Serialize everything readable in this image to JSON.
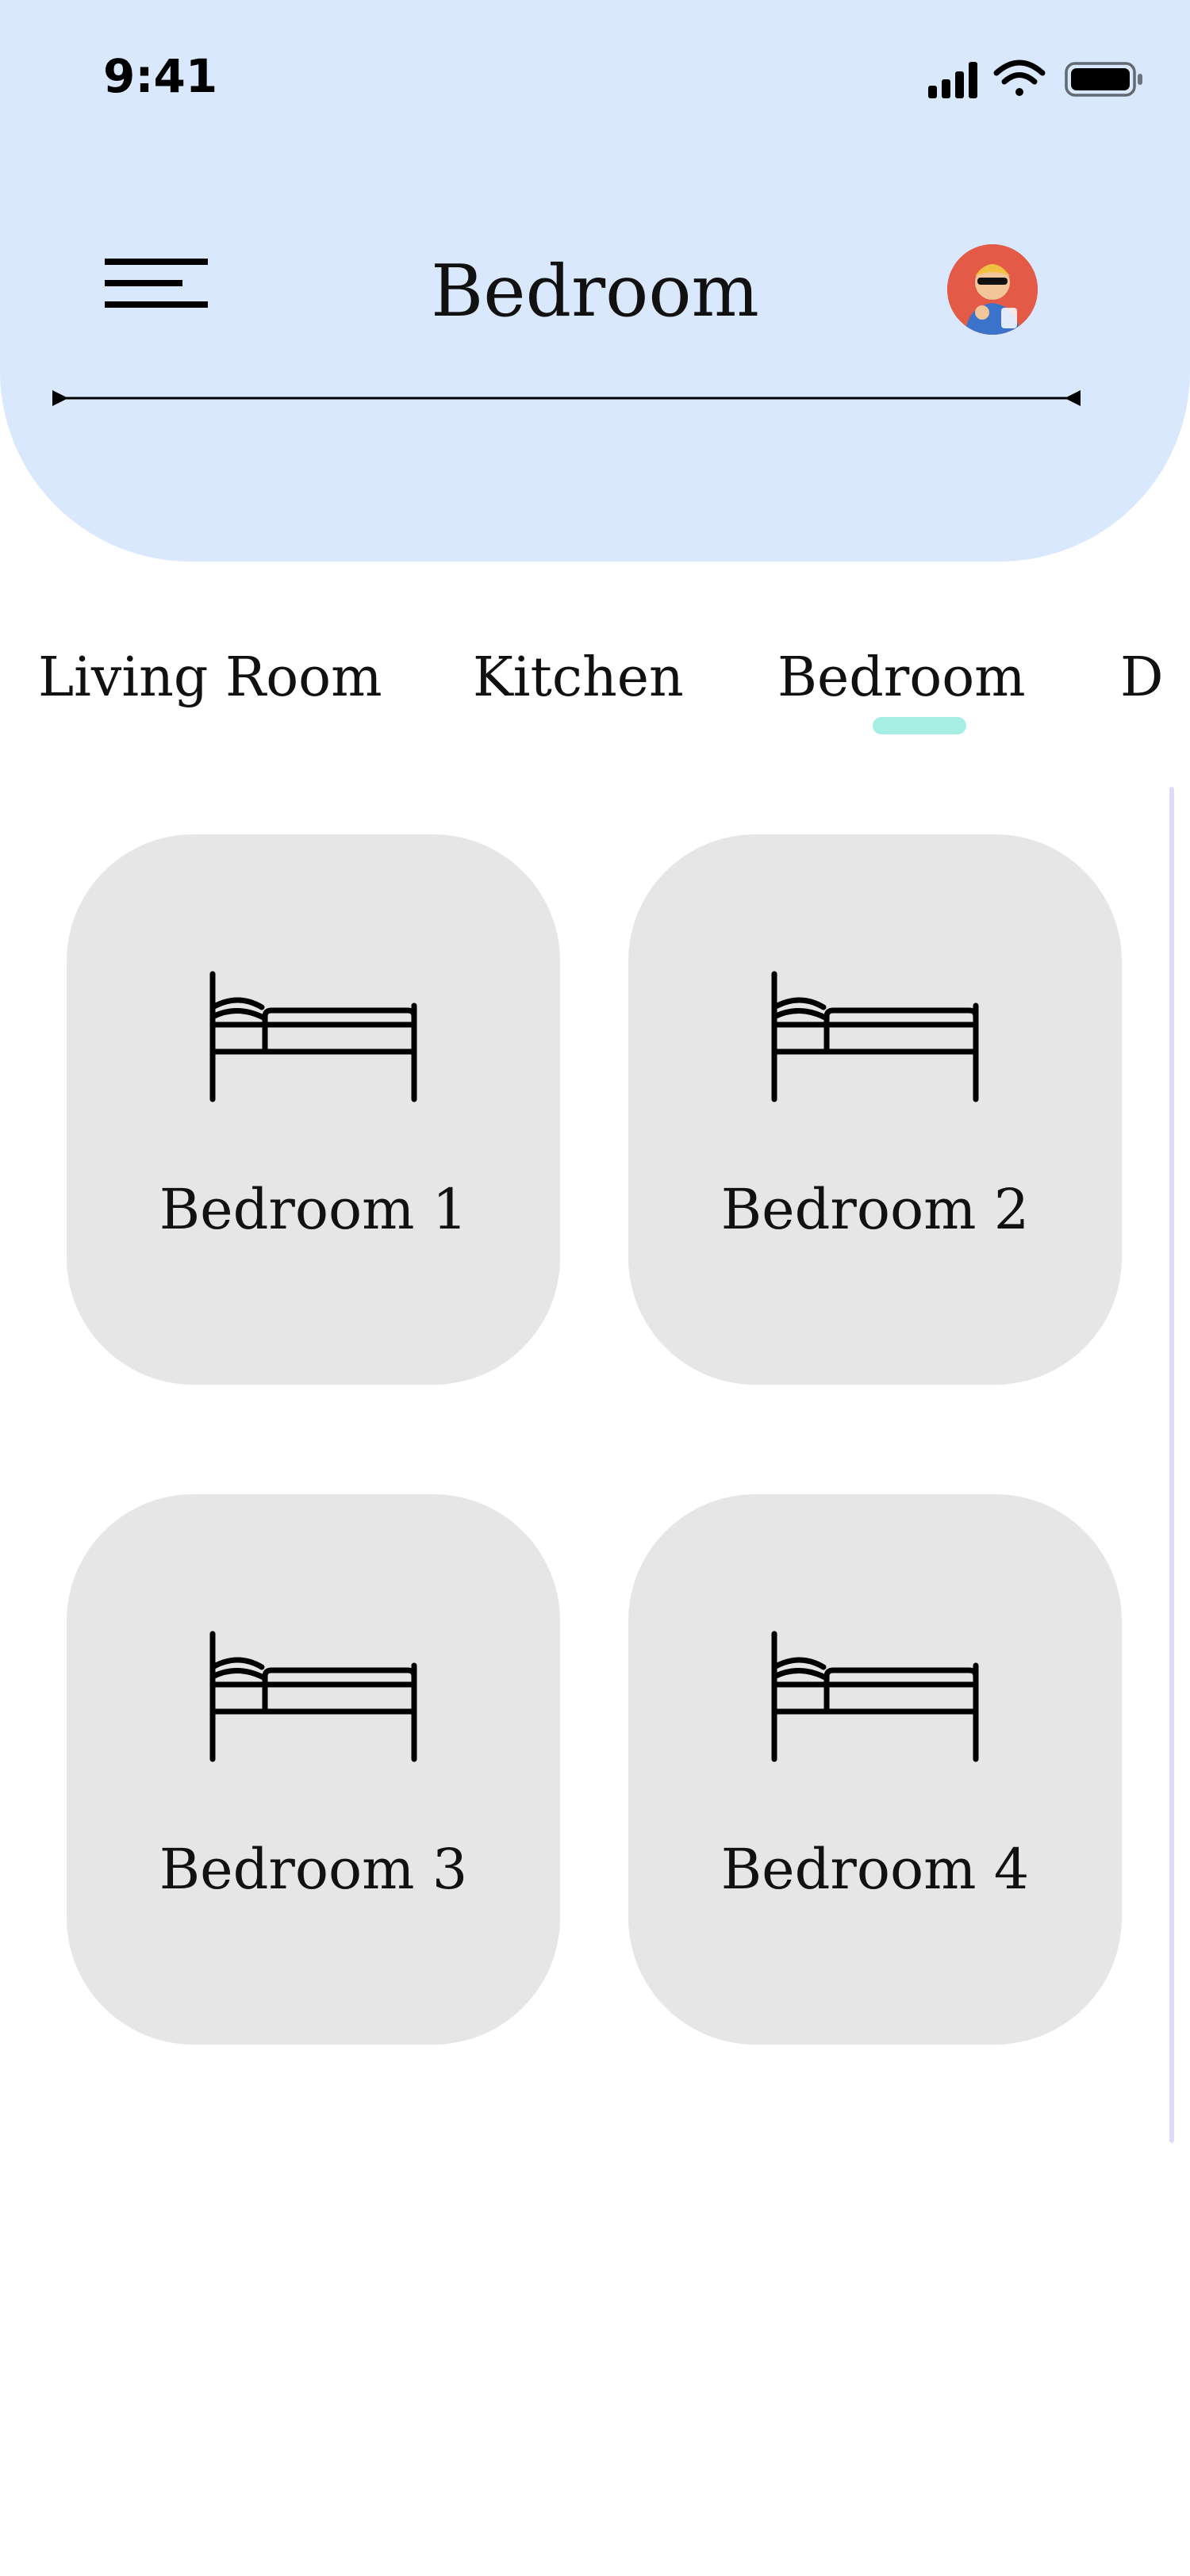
{
  "status_bar": {
    "time": "9:41"
  },
  "header": {
    "title": "Bedroom"
  },
  "tabs": [
    {
      "label": "Living Room",
      "active": false
    },
    {
      "label": "Kitchen",
      "active": false
    },
    {
      "label": "Bedroom",
      "active": true
    },
    {
      "label": "D",
      "active": false
    }
  ],
  "cards": [
    {
      "label": "Bedroom 1",
      "icon": "bed-icon"
    },
    {
      "label": "Bedroom 2",
      "icon": "bed-icon"
    },
    {
      "label": "Bedroom 3",
      "icon": "bed-icon"
    },
    {
      "label": "Bedroom 4",
      "icon": "bed-icon"
    }
  ],
  "colors": {
    "header_bg": "#d9e8fd",
    "card_bg": "#e6e6e6",
    "tab_indicator": "#a6eee3",
    "avatar_bg": "#e35a47"
  }
}
